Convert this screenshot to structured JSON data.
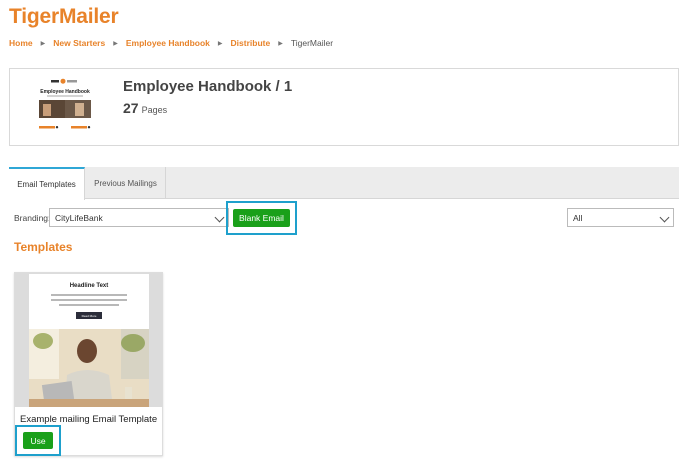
{
  "app": {
    "brand": "TigerMailer"
  },
  "breadcrumb": [
    {
      "label": "Home",
      "current": false
    },
    {
      "label": "New Starters",
      "current": false
    },
    {
      "label": "Employee Handbook",
      "current": false
    },
    {
      "label": "Distribute",
      "current": false
    },
    {
      "label": "TigerMailer",
      "current": true
    }
  ],
  "breadcrumb_separator_icon": "triangle-right-icon",
  "document": {
    "title": "Employee Handbook / 1",
    "page_count": "27",
    "pages_label": "Pages",
    "thumbnail_title": "Employee Handbook"
  },
  "tabs": [
    {
      "label": "Email Templates",
      "active": true
    },
    {
      "label": "Previous Mailings",
      "active": false
    }
  ],
  "filters": {
    "branding_label": "Branding:",
    "branding_value": "CityLifeBank",
    "blank_email_label": "Blank Email",
    "filter_value": "All"
  },
  "templates_heading": "Templates",
  "templates": [
    {
      "name": "Example mailing Email Template",
      "preview_headline": "Headline Text",
      "preview_button": "Read More",
      "use_label": "Use"
    }
  ],
  "colors": {
    "brand_orange": "#e8832a",
    "primary_green": "#1aa01a",
    "highlight_blue": "#1ea0cc",
    "tab_accent": "#2fa7d6"
  }
}
